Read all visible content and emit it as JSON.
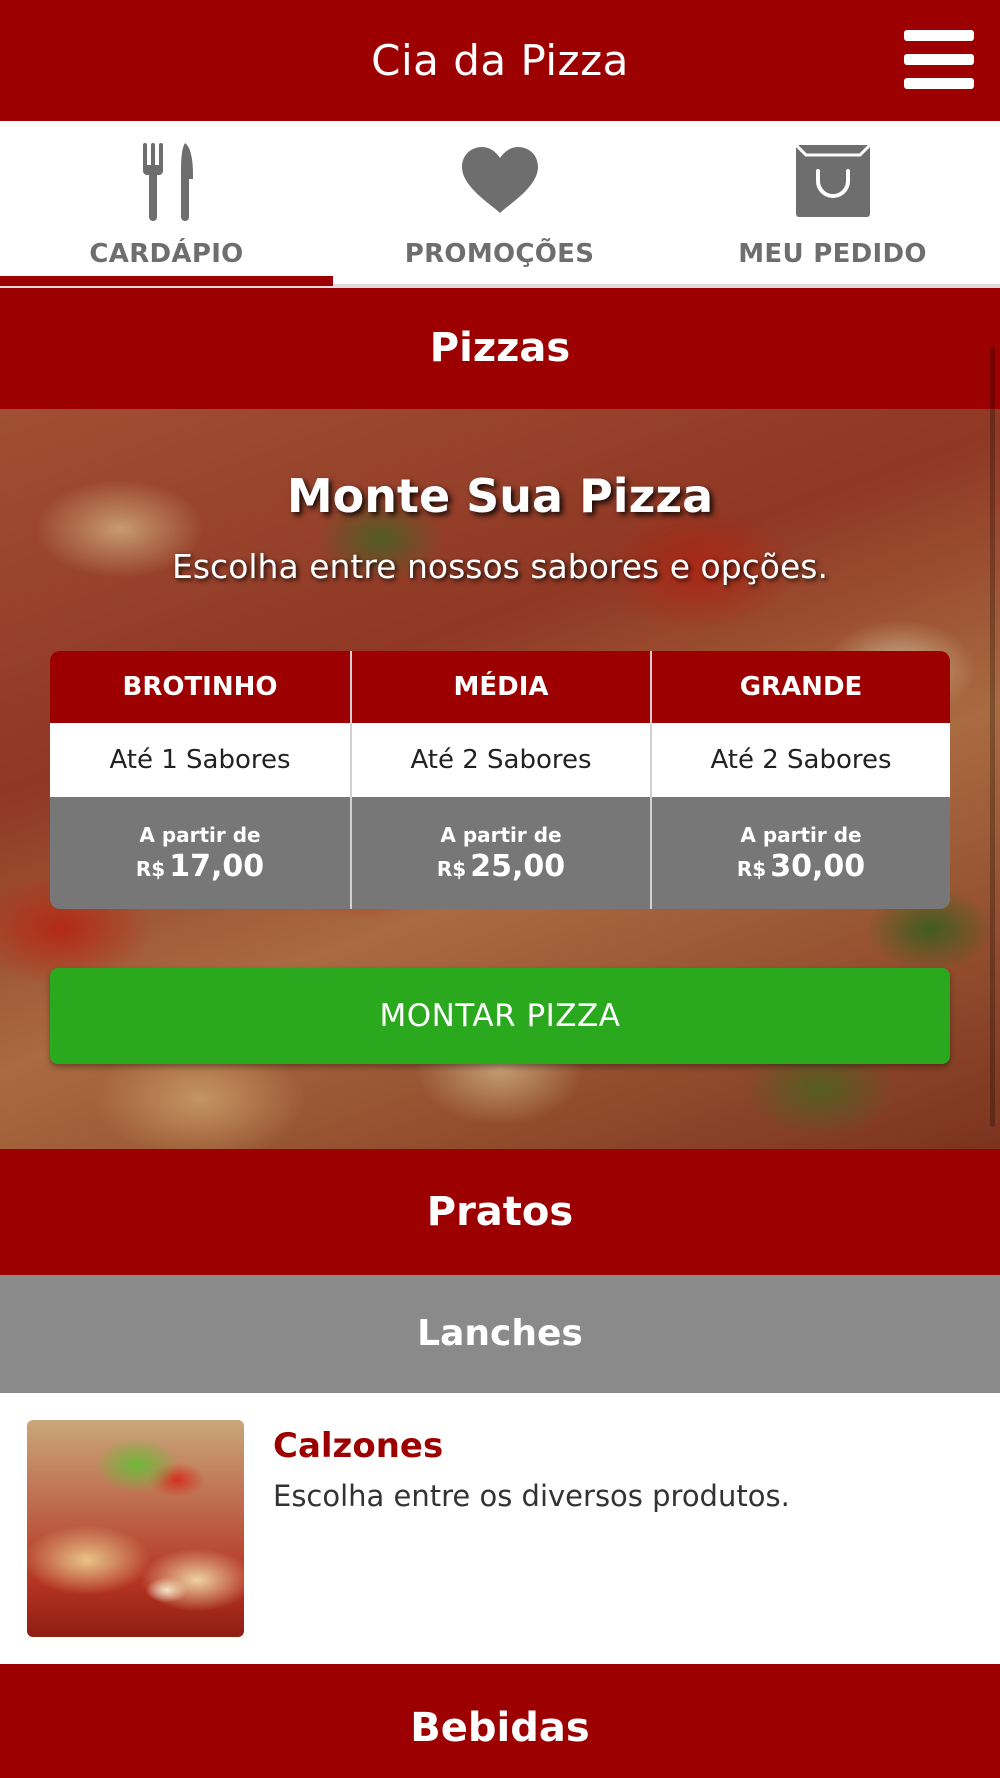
{
  "header": {
    "title": "Cia da Pizza"
  },
  "tabs": [
    {
      "label": "CARDÁPIO",
      "icon": "cutlery-icon",
      "active": true
    },
    {
      "label": "PROMOÇÕES",
      "icon": "heart-icon",
      "active": false
    },
    {
      "label": "MEU PEDIDO",
      "icon": "shopping-bag-icon",
      "active": false
    }
  ],
  "sections": {
    "pizzas": "Pizzas",
    "pratos": "Pratos",
    "lanches": "Lanches",
    "bebidas": "Bebidas"
  },
  "hero": {
    "title": "Monte Sua Pizza",
    "subtitle": "Escolha entre nossos sabores e opções.",
    "sizes": [
      {
        "name": "BROTINHO",
        "flavors": "Até 1 Sabores",
        "from": "A partir de",
        "currency": "R$",
        "price": "17,00"
      },
      {
        "name": "MÉDIA",
        "flavors": "Até 2 Sabores",
        "from": "A partir de",
        "currency": "R$",
        "price": "25,00"
      },
      {
        "name": "GRANDE",
        "flavors": "Até 2 Sabores",
        "from": "A partir de",
        "currency": "R$",
        "price": "30,00"
      }
    ],
    "build_button": "MONTAR PIZZA"
  },
  "products": [
    {
      "name": "Calzones",
      "description": "Escolha entre os diversos produtos."
    }
  ],
  "colors": {
    "brand": "#9d0000",
    "gray_bar": "#8a8a8a",
    "price_bg": "#777777",
    "cta": "#2aa91e",
    "tab_text": "#6e6e6e"
  }
}
